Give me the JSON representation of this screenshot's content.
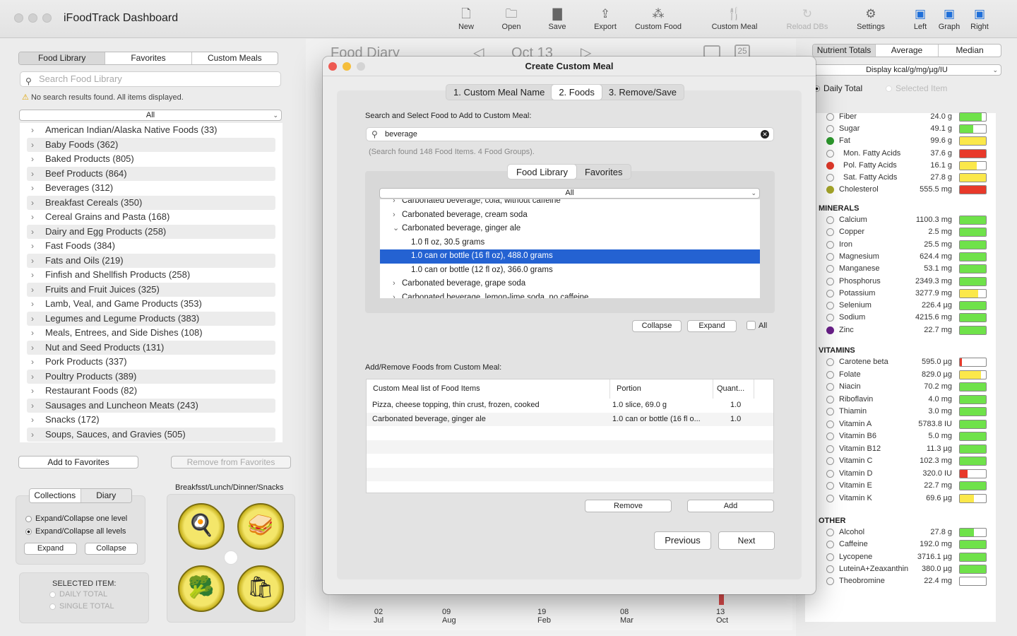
{
  "app": {
    "title": "iFoodTrack Dashboard"
  },
  "toolbar": {
    "items": [
      "New",
      "Open",
      "Save",
      "Export",
      "Custom Food",
      "Custom Meal",
      "Reload DBs",
      "Settings",
      "Left",
      "Graph",
      "Right"
    ]
  },
  "left": {
    "tabs": [
      "Food Library",
      "Favorites",
      "Custom Meals"
    ],
    "search_placeholder": "Search Food Library",
    "notice": "No search results found. All items displayed.",
    "filter": "All",
    "categories": [
      "American Indian/Alaska Native Foods (33)",
      "Baby Foods (362)",
      "Baked Products (805)",
      "Beef Products (864)",
      "Beverages (312)",
      "Breakfast Cereals (350)",
      "Cereal Grains and Pasta (168)",
      "Dairy and Egg Products (258)",
      "Fast Foods (384)",
      "Fats and Oils (219)",
      "Finfish and Shellfish Products (258)",
      "Fruits and Fruit Juices (325)",
      "Lamb, Veal, and Game Products (353)",
      "Legumes and Legume Products (383)",
      "Meals, Entrees, and Side Dishes (108)",
      "Nut and Seed Products (131)",
      "Pork Products (337)",
      "Poultry Products (389)",
      "Restaurant Foods (82)",
      "Sausages and Luncheon Meats (243)",
      "Snacks (172)",
      "Soups, Sauces, and Gravies (505)"
    ],
    "add_favorites": "Add to Favorites",
    "remove_favorites": "Remove from Favorites",
    "bottom_tabs": [
      "Collections",
      "Diary"
    ],
    "radio_one": "Expand/Collapse one level",
    "radio_all": "Expand/Collapse all levels",
    "expand": "Expand",
    "collapse": "Collapse",
    "selected_item_label": "SELECTED ITEM:",
    "daily_total": "DAILY TOTAL",
    "single_total": "SINGLE TOTAL",
    "meals_label": "Breakfsst/Lunch/Dinner/Snacks"
  },
  "middle": {
    "title": "Food Diary",
    "date": "Oct 13",
    "x_ticks": [
      {
        "day": "02",
        "month": "Jul"
      },
      {
        "day": "09",
        "month": "Aug"
      },
      {
        "day": "19",
        "month": "Feb"
      },
      {
        "day": "08",
        "month": "Mar"
      },
      {
        "day": "13",
        "month": "Oct"
      }
    ]
  },
  "right": {
    "tabs": [
      "Nutrient Totals",
      "Average",
      "Median"
    ],
    "display": "Display kcal/g/mg/µg/IU",
    "daily_total": "Daily Total",
    "selected_item": "Selected Item",
    "sections": {
      "minerals": "MINERALS",
      "vitamins": "VITAMINS",
      "other": "OTHER"
    },
    "top_rows": [
      {
        "name": "Fiber",
        "value": "24.0 g",
        "fill": 0.85,
        "color": "#6fe24a"
      },
      {
        "name": "Sugar",
        "value": "49.1 g",
        "fill": 0.5,
        "color": "#6fe24a"
      },
      {
        "name": "Fat",
        "value": "99.6 g",
        "fill": 1.0,
        "color": "#fbe84a",
        "dot": "#2d9a2d"
      },
      {
        "name": "Mon. Fatty Acids",
        "value": "37.6 g",
        "fill": 1.0,
        "color": "#e8392a",
        "indent": true
      },
      {
        "name": "Pol. Fatty Acids",
        "value": "16.1 g",
        "fill": 0.65,
        "color": "#fbe84a",
        "indent": true,
        "dot": "#e2392a"
      },
      {
        "name": "Sat. Fatty Acids",
        "value": "27.8 g",
        "fill": 1.0,
        "color": "#fbe84a",
        "indent": true
      },
      {
        "name": "Cholesterol",
        "value": "555.5 mg",
        "fill": 1.0,
        "color": "#e8392a",
        "dot": "#a8a82a"
      }
    ],
    "minerals": [
      {
        "name": "Calcium",
        "value": "1100.3 mg",
        "fill": 1.0,
        "color": "#6fe24a"
      },
      {
        "name": "Copper",
        "value": "2.5 mg",
        "fill": 1.0,
        "color": "#6fe24a"
      },
      {
        "name": "Iron",
        "value": "25.5 mg",
        "fill": 1.0,
        "color": "#6fe24a"
      },
      {
        "name": "Magnesium",
        "value": "624.4 mg",
        "fill": 1.0,
        "color": "#6fe24a"
      },
      {
        "name": "Manganese",
        "value": "53.1 mg",
        "fill": 1.0,
        "color": "#6fe24a"
      },
      {
        "name": "Phosphorus",
        "value": "2349.3 mg",
        "fill": 1.0,
        "color": "#6fe24a"
      },
      {
        "name": "Potassium",
        "value": "3277.9 mg",
        "fill": 0.7,
        "color": "#fbe84a"
      },
      {
        "name": "Selenium",
        "value": "226.4 µg",
        "fill": 1.0,
        "color": "#6fe24a"
      },
      {
        "name": "Sodium",
        "value": "4215.6 mg",
        "fill": 1.0,
        "color": "#6fe24a"
      },
      {
        "name": "Zinc",
        "value": "22.7 mg",
        "fill": 1.0,
        "color": "#6fe24a",
        "dot": "#6a1f8a"
      }
    ],
    "vitamins": [
      {
        "name": "Carotene beta",
        "value": "595.0 µg",
        "fill": 0.08,
        "color": "#e8392a"
      },
      {
        "name": "Folate",
        "value": "829.0 µg",
        "fill": 0.8,
        "color": "#fbe84a"
      },
      {
        "name": "Niacin",
        "value": "70.2 mg",
        "fill": 1.0,
        "color": "#6fe24a"
      },
      {
        "name": "Riboflavin",
        "value": "4.0 mg",
        "fill": 1.0,
        "color": "#6fe24a"
      },
      {
        "name": "Thiamin",
        "value": "3.0 mg",
        "fill": 1.0,
        "color": "#6fe24a"
      },
      {
        "name": "Vitamin A",
        "value": "5783.8 IU",
        "fill": 1.0,
        "color": "#6fe24a"
      },
      {
        "name": "Vitamin B6",
        "value": "5.0 mg",
        "fill": 1.0,
        "color": "#6fe24a"
      },
      {
        "name": "Vitamin B12",
        "value": "11.3 µg",
        "fill": 1.0,
        "color": "#6fe24a"
      },
      {
        "name": "Vitamin C",
        "value": "102.3 mg",
        "fill": 1.0,
        "color": "#6fe24a"
      },
      {
        "name": "Vitamin D",
        "value": "320.0 IU",
        "fill": 0.3,
        "color": "#e8392a"
      },
      {
        "name": "Vitamin E",
        "value": "22.7 mg",
        "fill": 1.0,
        "color": "#6fe24a"
      },
      {
        "name": "Vitamin K",
        "value": "69.6 µg",
        "fill": 0.55,
        "color": "#fbe84a"
      }
    ],
    "other": [
      {
        "name": "Alcohol",
        "value": "27.8 g",
        "fill": 0.55,
        "color": "#6fe24a"
      },
      {
        "name": "Caffeine",
        "value": "192.0 mg",
        "fill": 1.0,
        "color": "#6fe24a"
      },
      {
        "name": "Lycopene",
        "value": "3716.1 µg",
        "fill": 1.0,
        "color": "#6fe24a"
      },
      {
        "name": "LuteinA+Zeaxanthin",
        "value": "380.0 µg",
        "fill": 1.0,
        "color": "#6fe24a"
      },
      {
        "name": "Theobromine",
        "value": "22.4 mg",
        "fill": 0.0,
        "color": "#6fe24a"
      }
    ]
  },
  "dialog": {
    "title": "Create Custom Meal",
    "steps": [
      "1. Custom Meal Name",
      "2. Foods",
      "3. Remove/Save"
    ],
    "search_label": "Search and Select Food to Add to Custom Meal:",
    "search_value": "beverage",
    "search_result": "(Search found 148 Food Items. 4 Food Groups).",
    "lib_tabs": [
      "Food Library",
      "Favorites"
    ],
    "filter": "All",
    "tree": [
      {
        "text": "Carbonated beverage, cola, without caffeine",
        "level": 0,
        "chev": "›"
      },
      {
        "text": "Carbonated beverage, cream soda",
        "level": 0,
        "chev": "›"
      },
      {
        "text": "Carbonated beverage, ginger ale",
        "level": 0,
        "chev": "⌄"
      },
      {
        "text": "1.0 fl oz, 30.5 grams",
        "level": 1,
        "chev": ""
      },
      {
        "text": "1.0 can or bottle (16 fl oz), 488.0 grams",
        "level": 1,
        "chev": "",
        "selected": true
      },
      {
        "text": "1.0 can or bottle (12 fl oz), 366.0 grams",
        "level": 1,
        "chev": ""
      },
      {
        "text": "Carbonated beverage, grape soda",
        "level": 0,
        "chev": "›"
      },
      {
        "text": "Carbonated beverage, lemon-lime soda, no caffeine",
        "level": 0,
        "chev": "›"
      }
    ],
    "collapse": "Collapse",
    "expand": "Expand",
    "all": "All",
    "table_label": "Add/Remove Foods from Custom Meal:",
    "table_headers": [
      "Custom Meal list of Food Items",
      "Portion",
      "Quant..."
    ],
    "rows": [
      [
        "Pizza, cheese topping, thin crust, frozen, cooked",
        "1.0 slice, 69.0 g",
        "1.0"
      ],
      [
        "Carbonated beverage, ginger ale",
        "1.0 can or bottle (16 fl o...",
        "1.0"
      ]
    ],
    "remove": "Remove",
    "add": "Add",
    "previous": "Previous",
    "next": "Next"
  }
}
